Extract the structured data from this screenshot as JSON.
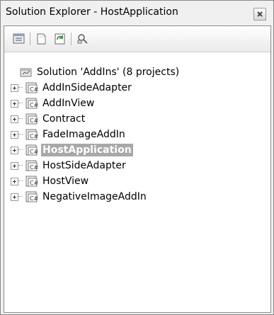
{
  "window": {
    "title": "Solution Explorer - HostApplication"
  },
  "toolbar": {
    "buttons": [
      {
        "name": "properties-button",
        "icon": "properties-icon"
      },
      {
        "name": "show-all-files-button",
        "icon": "show-all-files-icon"
      },
      {
        "name": "refresh-button",
        "icon": "refresh-icon"
      },
      {
        "name": "class-view-button",
        "icon": "class-view-icon"
      }
    ]
  },
  "tree": {
    "solution": {
      "label": "Solution 'AddIns' (8 projects)",
      "icon": "solution-icon"
    },
    "projects": [
      {
        "label": "AddInSideAdapter",
        "icon": "csharp-project-icon",
        "selected": false
      },
      {
        "label": "AddInView",
        "icon": "csharp-project-icon",
        "selected": false
      },
      {
        "label": "Contract",
        "icon": "csharp-project-icon",
        "selected": false
      },
      {
        "label": "FadeImageAddIn",
        "icon": "csharp-project-icon",
        "selected": false
      },
      {
        "label": "HostApplication",
        "icon": "csharp-project-icon",
        "selected": true
      },
      {
        "label": "HostSideAdapter",
        "icon": "csharp-project-icon",
        "selected": false
      },
      {
        "label": "HostView",
        "icon": "csharp-project-icon",
        "selected": false
      },
      {
        "label": "NegativeImageAddIn",
        "icon": "csharp-project-icon",
        "selected": false
      }
    ]
  },
  "colors": {
    "selection_bg": "#a8a8a8",
    "panel_bg": "#f0f0f0"
  }
}
